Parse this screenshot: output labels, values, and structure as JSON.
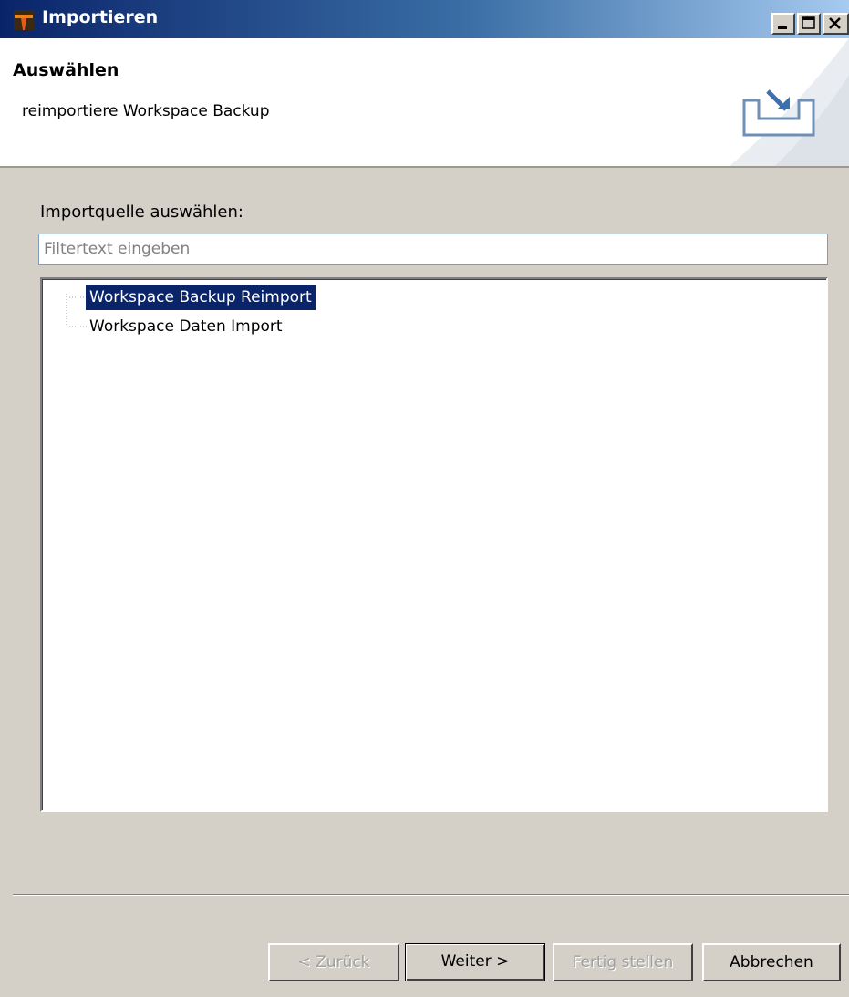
{
  "window": {
    "title": "Importieren",
    "title_color": "#0a246a"
  },
  "banner": {
    "title": "Auswählen",
    "description": "reimportiere Workspace Backup",
    "icon": "import-wizard-icon"
  },
  "main": {
    "source_label": "Importquelle auswählen:",
    "filter": {
      "value": "",
      "placeholder": "Filtertext eingeben"
    },
    "tree": {
      "items": [
        {
          "label": "Workspace Backup Reimport",
          "selected": true
        },
        {
          "label": "Workspace Daten Import",
          "selected": false
        }
      ]
    }
  },
  "buttons": {
    "back": {
      "label": "< Zurück",
      "enabled": false
    },
    "next": {
      "label": "Weiter >",
      "enabled": true
    },
    "finish": {
      "label": "Fertig stellen",
      "enabled": false
    },
    "cancel": {
      "label": "Abbrechen",
      "enabled": true
    }
  },
  "colors": {
    "selection": "#0a246a",
    "dialog_bg": "#d4d0c8"
  }
}
